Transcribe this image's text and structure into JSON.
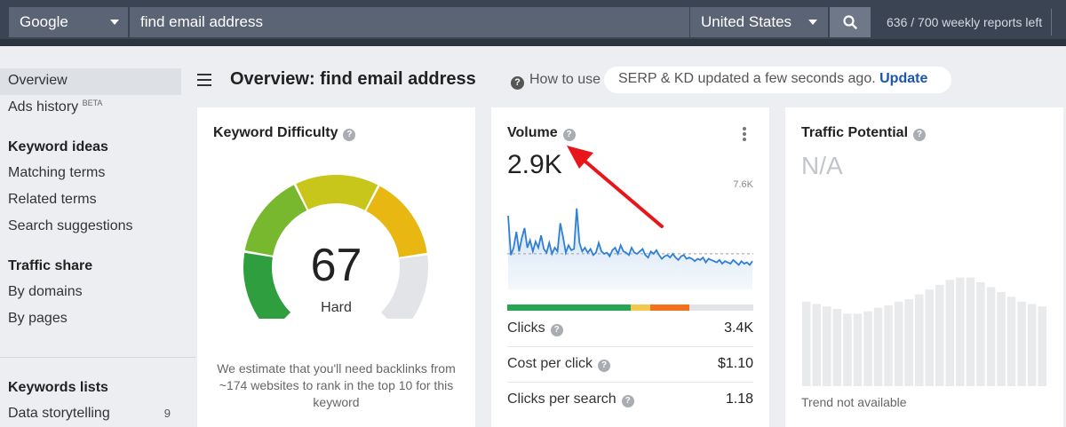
{
  "topbar": {
    "engine": "Google",
    "query": "find email address",
    "country": "United States",
    "reports_left": "636 / 700 weekly reports left"
  },
  "sidebar": {
    "items_top": [
      {
        "label": "Overview",
        "active": true
      },
      {
        "label": "Ads history",
        "badge": "BETA"
      }
    ],
    "keyword_ideas": {
      "heading": "Keyword ideas",
      "items": [
        "Matching terms",
        "Related terms",
        "Search suggestions"
      ]
    },
    "traffic_share": {
      "heading": "Traffic share",
      "items": [
        "By domains",
        "By pages"
      ]
    },
    "keywords_lists": {
      "heading": "Keywords lists",
      "items": [
        {
          "label": "Data storytelling",
          "count": "9"
        }
      ]
    }
  },
  "header": {
    "title": "Overview: find email address",
    "how_to_use": "How to use",
    "serp_status": "SERP & KD updated a few seconds ago.",
    "update_label": "Update"
  },
  "kd_card": {
    "title": "Keyword Difficulty",
    "value": "67",
    "label": "Hard",
    "description": "We estimate that you'll need backlinks from ~174 websites to rank in the top 10 for this keyword",
    "score_fraction": 0.67,
    "colors": [
      "#2e9e3e",
      "#77b82f",
      "#c8c61a",
      "#e8b711",
      "#e2e4e7"
    ]
  },
  "volume_card": {
    "title": "Volume",
    "value": "2.9K",
    "chart_max_label": "7.6K",
    "trend": [
      6.0,
      2.8,
      3.4,
      4.7,
      3.1,
      4.2,
      5.0,
      3.4,
      4.0,
      3.1,
      3.9,
      3.4,
      4.4,
      3.3,
      3.0,
      3.8,
      2.9,
      3.4,
      3.1,
      5.4,
      4.3,
      3.0,
      3.6,
      3.2,
      3.3,
      6.6,
      3.8,
      3.1,
      3.4,
      3.0,
      3.3,
      2.8,
      3.0,
      3.8,
      3.1,
      2.9,
      3.0,
      2.7,
      3.2,
      3.4,
      2.9,
      3.6,
      3.1,
      3.0,
      2.8,
      3.4,
      3.0,
      2.9,
      3.1,
      3.3,
      2.8,
      2.6,
      3.1,
      2.9,
      3.2,
      2.8,
      2.5,
      2.7,
      2.8,
      2.6,
      2.9,
      2.6,
      2.4,
      2.7,
      2.8,
      2.5,
      2.6,
      2.5,
      2.3,
      2.5,
      2.4,
      2.6,
      2.2,
      2.5,
      2.4,
      2.3,
      2.2,
      2.4,
      2.1,
      2.3,
      2.2,
      2.1,
      2.4,
      2.2,
      2.0,
      2.3,
      2.1,
      2.2,
      2.0,
      2.3
    ],
    "chart_max": 7.6,
    "avg_line": 2.9,
    "split": [
      {
        "color": "#27a554",
        "fraction": 0.5
      },
      {
        "color": "#f2c94c",
        "fraction": 0.08
      },
      {
        "color": "#f2711c",
        "fraction": 0.16
      },
      {
        "color": "#e2e4e7",
        "fraction": 0.26
      }
    ],
    "metrics": [
      {
        "label": "Clicks",
        "value": "3.4K"
      },
      {
        "label": "Cost per click",
        "value": "$1.10"
      },
      {
        "label": "Clicks per search",
        "value": "1.18"
      }
    ]
  },
  "tp_card": {
    "title": "Traffic Potential",
    "value": "N/A",
    "note": "Trend not available",
    "bars": [
      0.7,
      0.68,
      0.66,
      0.64,
      0.6,
      0.6,
      0.62,
      0.65,
      0.67,
      0.7,
      0.72,
      0.76,
      0.8,
      0.84,
      0.88,
      0.9,
      0.9,
      0.86,
      0.82,
      0.78,
      0.74,
      0.7,
      0.68,
      0.66
    ]
  },
  "colors": {
    "topbar": "#3b4453",
    "accent_link": "#1a56b0",
    "annotation_arrow": "#e8151b"
  }
}
